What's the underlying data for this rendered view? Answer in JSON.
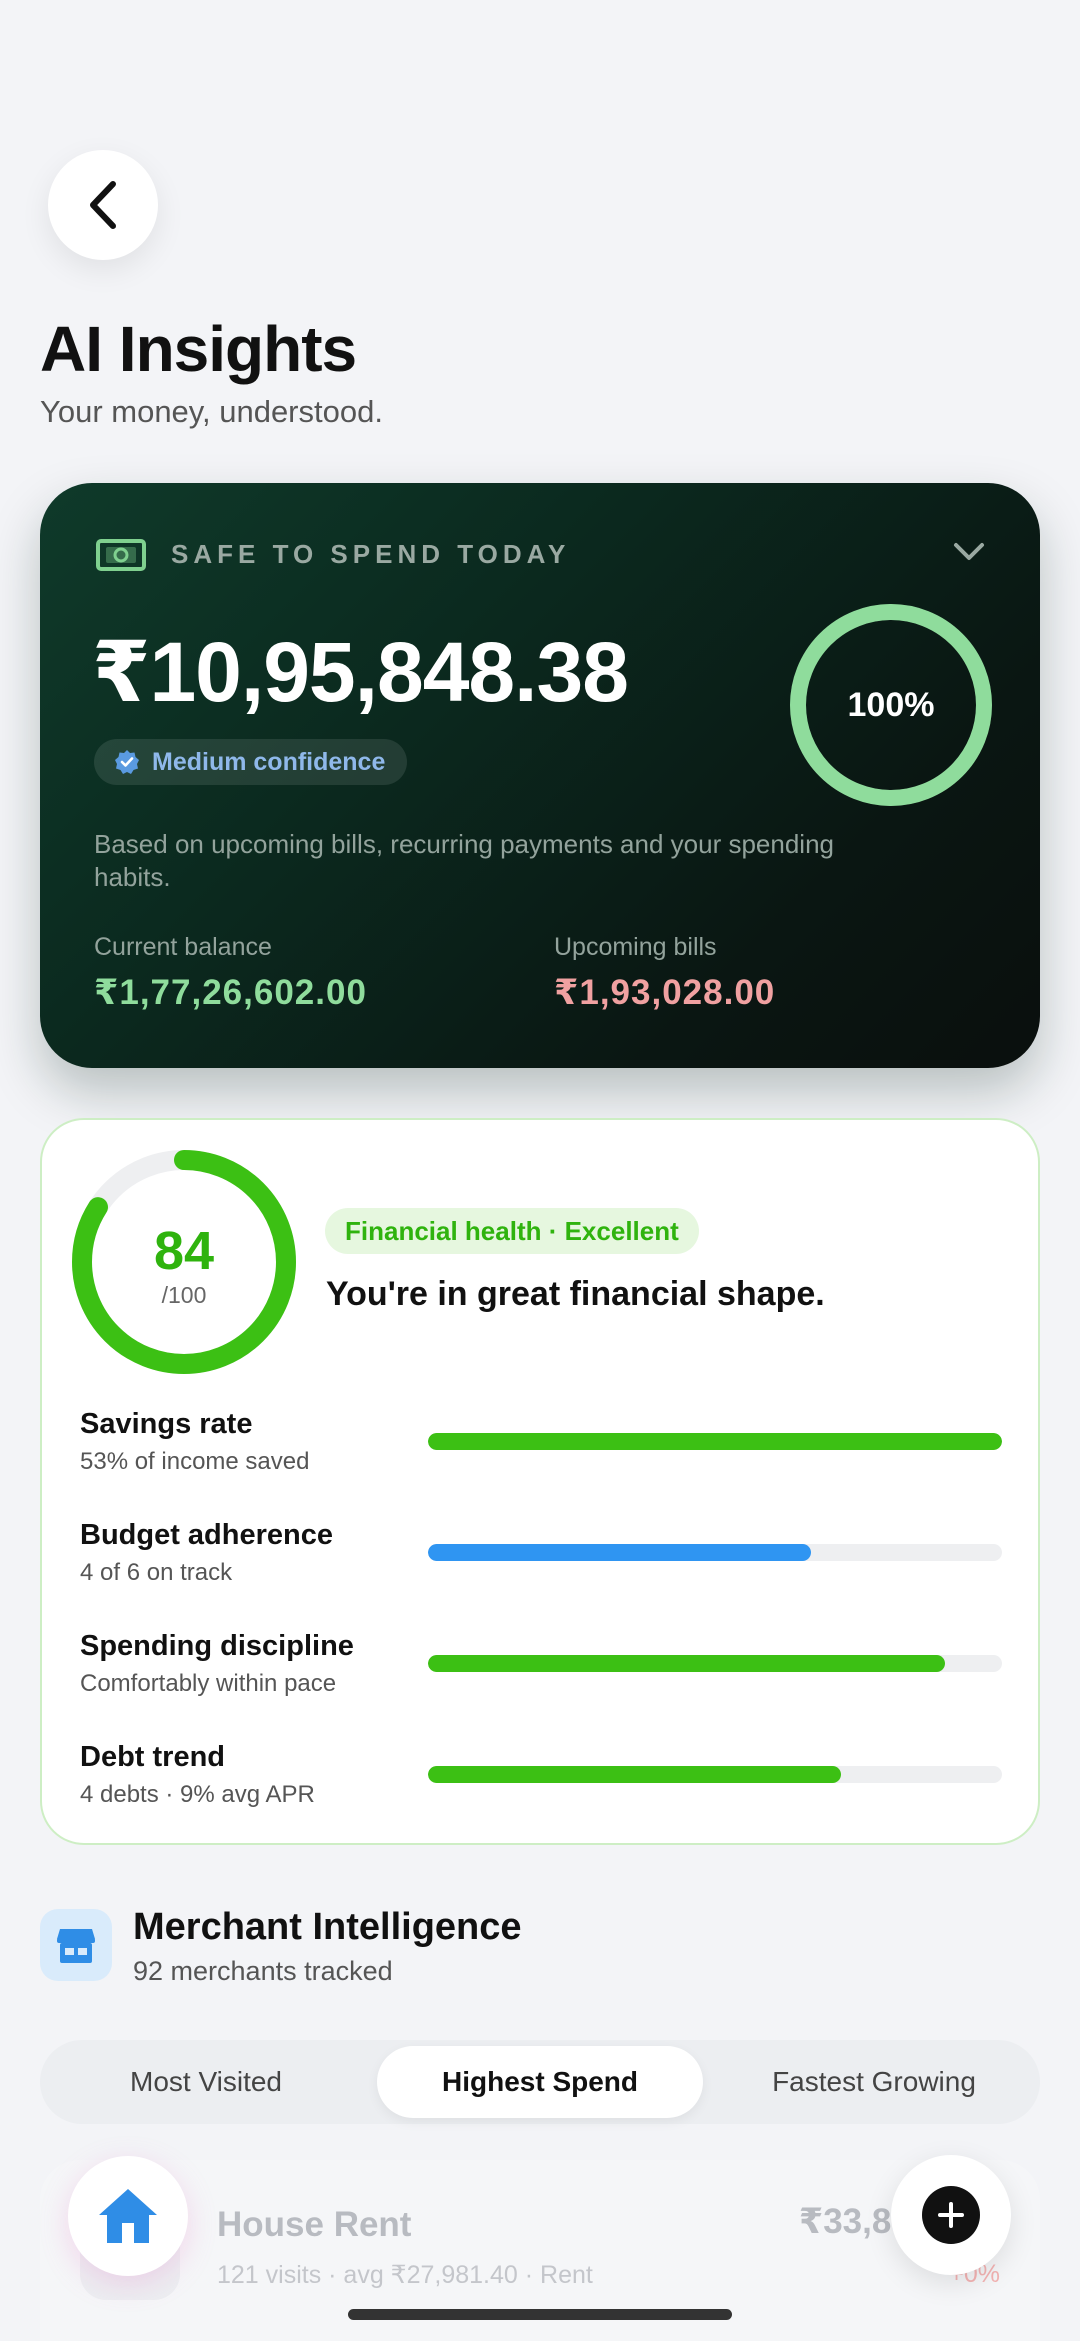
{
  "header": {
    "title": "AI Insights",
    "subtitle": "Your money, understood."
  },
  "safe_to_spend": {
    "label": "SAFE TO SPEND TODAY",
    "amount": "₹10,95,848.38",
    "confidence": "Medium confidence",
    "ring_label": "100%",
    "ring_progress": 1.0,
    "description": "Based on upcoming bills, recurring payments and your spending habits.",
    "current_balance_label": "Current balance",
    "current_balance": "₹1,77,26,602.00",
    "upcoming_bills_label": "Upcoming bills",
    "upcoming_bills": "₹1,93,028.00",
    "colors": {
      "positive": "#8fdc9c",
      "negative": "#f0a1a1",
      "ring": "#8fdc9c"
    }
  },
  "health": {
    "score": "84",
    "max": "/100",
    "score_fraction": 0.84,
    "pill": "Financial health · Excellent",
    "headline": "You're in great financial shape.",
    "metrics": [
      {
        "title": "Savings rate",
        "subtitle": "53% of income saved",
        "value": 1.0,
        "color": "#3cc014"
      },
      {
        "title": "Budget adherence",
        "subtitle": "4 of 6 on track",
        "value": 0.667,
        "color": "#2f95f2"
      },
      {
        "title": "Spending discipline",
        "subtitle": "Comfortably within pace",
        "value": 0.9,
        "color": "#3cc014"
      },
      {
        "title": "Debt trend",
        "subtitle": "4 debts · 9% avg APR",
        "value": 0.72,
        "color": "#3cc014"
      }
    ]
  },
  "merchants": {
    "title": "Merchant Intelligence",
    "subtitle": "92 merchants tracked",
    "tabs": [
      {
        "label": "Most Visited",
        "active": false
      },
      {
        "label": "Highest Spend",
        "active": true
      },
      {
        "label": "Fastest Growing",
        "active": false
      }
    ],
    "rows": [
      {
        "name": "House Rent",
        "meta": "121 visits · avg ₹27,981.40 · Rent",
        "amount": "₹33,85,7",
        "change": "+0%"
      }
    ]
  },
  "icons": {
    "back": "chevron-left-icon",
    "cash": "cash-icon",
    "expand": "chevron-down-icon",
    "verified": "verified-badge-icon",
    "store": "store-icon",
    "home": "home-icon",
    "add": "plus-icon"
  }
}
